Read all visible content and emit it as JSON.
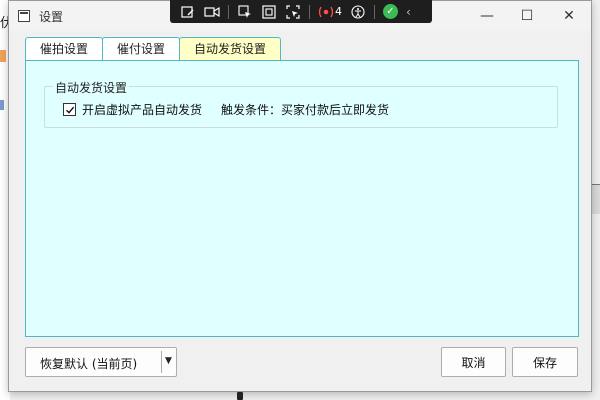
{
  "background": {
    "left_fragment_text": "伏"
  },
  "window": {
    "title": "设置",
    "controls": {
      "minimize": "—",
      "maximize": "☐",
      "close": "✕"
    }
  },
  "overlay_toolbar": {
    "badge_count": "4"
  },
  "tabs": [
    {
      "label": "催拍设置",
      "active": false
    },
    {
      "label": "催付设置",
      "active": false
    },
    {
      "label": "自动发货设置",
      "active": true
    }
  ],
  "panel": {
    "group_title": "自动发货设置",
    "checkbox_label": "开启虚拟产品自动发货",
    "checkbox_checked": true,
    "trigger_text": "触发条件：买家付款后立即发货"
  },
  "buttons": {
    "restore_default": "恢复默认 (当前页)",
    "cancel": "取消",
    "save": "保存"
  },
  "colors": {
    "panel_bg": "#e0ffff",
    "tab_border": "#4fb8c2",
    "active_tab_bg": "#ffffc6",
    "toolbar_bg": "#1e1e1e",
    "check_green": "#3cba54",
    "badge_red": "#ff4c4c"
  }
}
